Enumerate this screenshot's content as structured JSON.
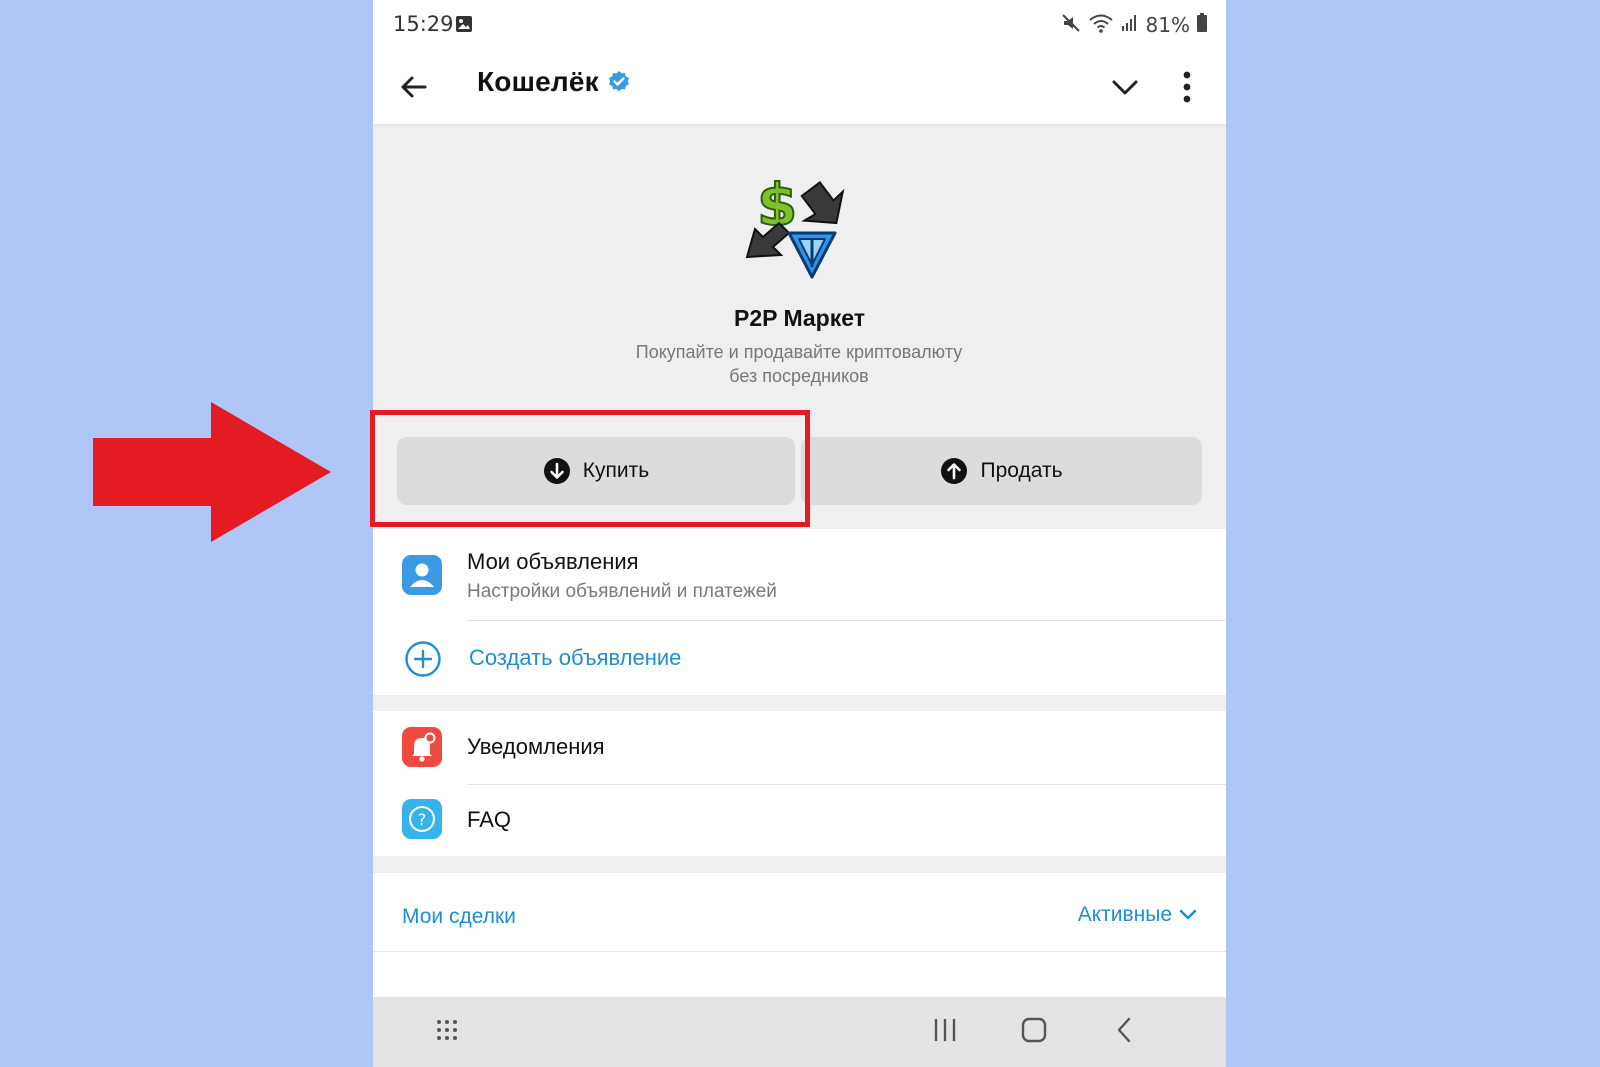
{
  "status_bar": {
    "time": "15:29",
    "battery": "81%",
    "icons": [
      "gallery-icon",
      "mute-icon",
      "wifi-icon",
      "signal-icon",
      "battery-icon"
    ]
  },
  "header": {
    "title": "Кошелёк",
    "verified": true,
    "icons": [
      "back-arrow-icon",
      "verified-badge-icon",
      "chevron-down-icon",
      "more-vert-icon"
    ]
  },
  "hero": {
    "title": "P2P Маркет",
    "subtitle_line1": "Покупайте и продавайте криптовалюту",
    "subtitle_line2": "без посредников",
    "buy_label": "Купить",
    "sell_label": "Продать"
  },
  "list": {
    "my_ads_title": "Мои объявления",
    "my_ads_subtitle": "Настройки объявлений и платежей",
    "create_ad_label": "Создать объявление",
    "notifications_label": "Уведомления",
    "faq_label": "FAQ"
  },
  "deals": {
    "title": "Мои сделки",
    "filter_label": "Активные"
  },
  "colors": {
    "accent": "#1e8ed6",
    "page_background": "#afc6f7",
    "annotation": "#e41b23",
    "hero_background": "#efefef"
  }
}
